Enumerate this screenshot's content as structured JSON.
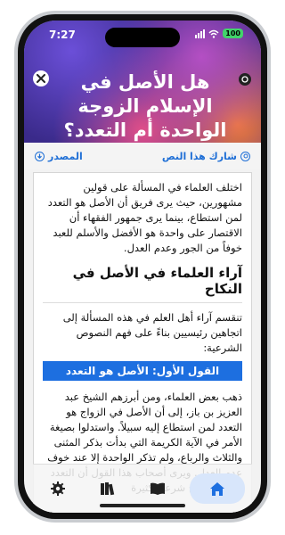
{
  "status": {
    "time": "7:27",
    "battery": "100"
  },
  "header": {
    "title": "هل الأصل في الإسلام الزوجة الواحدة أم التعدد؟"
  },
  "actions": {
    "share_label": "شارك هذا النص",
    "source_label": "المصدر"
  },
  "article": {
    "intro": "اختلف العلماء في المسألة على قولين مشهورين، حيث يرى فريق أن الأصل هو التعدد لمن استطاع، بينما يرى جمهور الفقهاء أن الاقتصار على واحدة هو الأفضل والأسلم للعبد خوفاً من الجور وعدم العدل.",
    "section_heading": "آراء العلماء في الأصل في النكاح",
    "section_intro": "تنقسم آراء أهل العلم في هذه المسألة إلى اتجاهين رئيسيين بناءً على فهم النصوص الشرعية:",
    "sub_heading": "القول الأول: الأصل هو التعدد",
    "body": "ذهب بعض العلماء، ومن أبرزهم الشيخ عبد العزيز بن باز، إلى أن الأصل في الزواج هو التعدد لمن استطاع إليه سبيلاً. واستدلوا بصيغة الأمر في الآية الكريمة التي بدأت بذكر المثنى والثلاث والرباع، ولم تذكر الواحدة إلا عند خوف عدم العدل. ويرى أصحاب هذا القول أن التعدد يحقق مصالح شرعية كثيرة"
  },
  "tabs": [
    {
      "name": "settings",
      "icon": "gear-icon"
    },
    {
      "name": "library",
      "icon": "books-icon"
    },
    {
      "name": "reading",
      "icon": "open-book-icon"
    },
    {
      "name": "home",
      "icon": "home-icon",
      "active": true
    }
  ],
  "colors": {
    "accent": "#1d6fe0",
    "link": "#1f6fd6"
  }
}
